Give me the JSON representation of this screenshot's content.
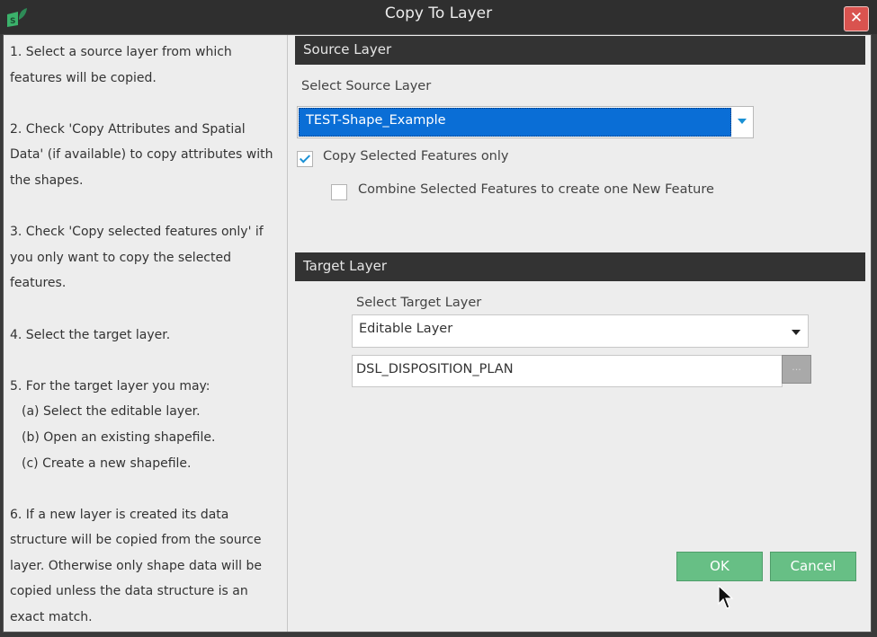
{
  "window": {
    "title": "Copy To Layer",
    "close_label": "✕"
  },
  "instructions": {
    "step1": "1. Select a source layer from which features will be copied.",
    "step2": "2. Check 'Copy Attributes and Spatial Data' (if available) to copy attributes with the shapes.",
    "step3": "3. Check 'Copy selected features only' if you only want to copy the selected features.",
    "step4": "4. Select the target layer.",
    "step5": "5. For the target layer you may:",
    "step5a": "(a) Select the editable layer.",
    "step5b": "(b) Open an existing shapefile.",
    "step5c": "(c) Create a new shapefile.",
    "step6": "6. If a new layer is created its data structure will be copied from the source layer. Otherwise only shape data will be copied unless the data structure is an exact match."
  },
  "source": {
    "header": "Source Layer",
    "select_label": "Select Source Layer",
    "selected_layer": "TEST-Shape_Example",
    "copy_selected_label": "Copy Selected Features only",
    "copy_selected_checked": true,
    "combine_label": "Combine Selected Features to create one New Feature",
    "combine_checked": false
  },
  "target": {
    "header": "Target Layer",
    "select_label": "Select Target Layer",
    "selected_layer": "Editable Layer",
    "path_value": "DSL_DISPOSITION_PLAN",
    "browse_label": "..."
  },
  "buttons": {
    "ok_label": "OK",
    "cancel_label": "Cancel"
  },
  "colors": {
    "accent": "#0a6ed6",
    "button_green": "#67bf85",
    "close_red": "#d9534f",
    "header_dark": "#333333"
  }
}
